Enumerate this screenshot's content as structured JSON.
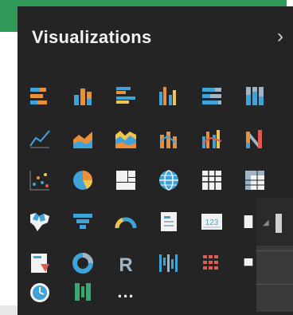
{
  "panel": {
    "title": "Visualizations",
    "expand_icon": "chevron-right-icon",
    "more_label": "..."
  },
  "visual_types": [
    "stacked-bar-chart",
    "stacked-column-chart",
    "clustered-bar-chart",
    "clustered-column-chart",
    "100-percent-stacked-bar-chart",
    "100-percent-stacked-column-chart",
    "line-chart",
    "area-chart",
    "stacked-area-chart",
    "line-and-stacked-column-chart",
    "line-and-clustered-column-chart",
    "ribbon-chart",
    "scatter-chart",
    "pie-chart",
    "treemap",
    "map",
    "table",
    "matrix",
    "filled-map",
    "funnel",
    "gauge",
    "card",
    "multi-row-card",
    "slicer",
    "kpi",
    "donut-chart",
    "r-script-visual",
    "waterfall-chart",
    "shape-map",
    "slicer-partial",
    "gauge-clock-visual",
    "custom-visual",
    "more-options"
  ],
  "colors": {
    "accent_green": "#2f9a57",
    "panel_bg": "#242424",
    "icon_blue": "#3ea3d8",
    "icon_orange": "#e8913a",
    "icon_yellow": "#f0c54a",
    "icon_red": "#e05a4f"
  }
}
